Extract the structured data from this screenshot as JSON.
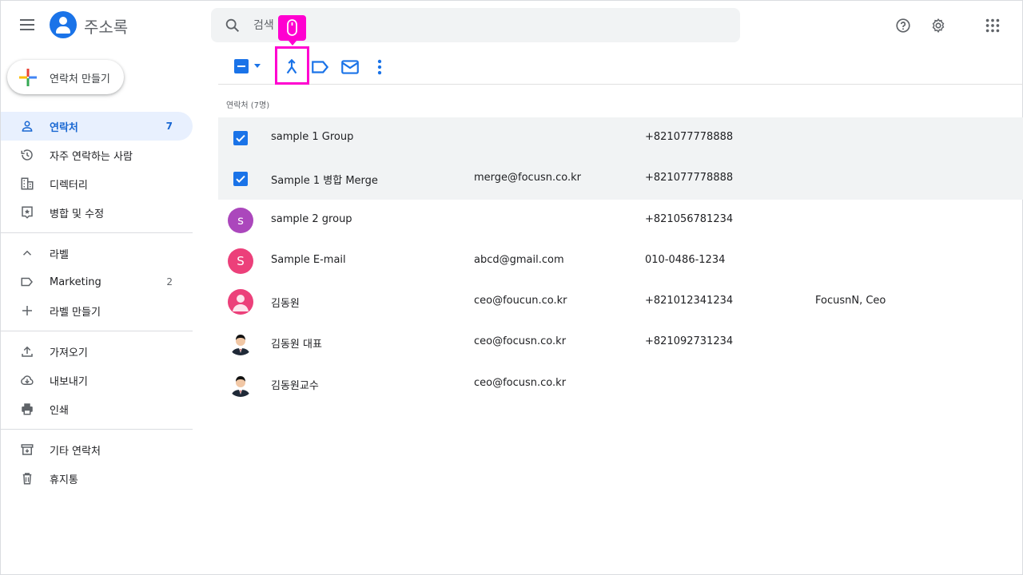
{
  "app": {
    "title": "주소록"
  },
  "search": {
    "placeholder": "검색"
  },
  "create_button": {
    "label": "연락처 만들기"
  },
  "sidebar": {
    "items": [
      {
        "label": "연락처",
        "count": "7",
        "active": true,
        "icon": "person-icon"
      },
      {
        "label": "자주 연락하는 사람",
        "count": "",
        "icon": "history-icon"
      },
      {
        "label": "디렉터리",
        "count": "",
        "icon": "building-icon"
      },
      {
        "label": "병합 및 수정",
        "count": "",
        "icon": "merge-fix-icon"
      }
    ],
    "labels_header": "라벨",
    "labels": [
      {
        "label": "Marketing",
        "count": "2",
        "icon": "label-icon"
      },
      {
        "label": "라벨 만들기",
        "count": "",
        "icon": "plus-icon"
      }
    ],
    "tools": [
      {
        "label": "가져오기",
        "icon": "upload-icon"
      },
      {
        "label": "내보내기",
        "icon": "cloud-download-icon"
      },
      {
        "label": "인쇄",
        "icon": "print-icon"
      }
    ],
    "other": [
      {
        "label": "기타 연락처",
        "icon": "archive-icon"
      },
      {
        "label": "휴지통",
        "icon": "trash-icon"
      }
    ]
  },
  "list": {
    "header": "연락처 (7명)",
    "rows": [
      {
        "name": "sample 1 Group",
        "email": "",
        "phone": "+821077778888",
        "org": "",
        "selected": true
      },
      {
        "name": "Sample 1 병합 Merge",
        "email": "merge@focusn.co.kr",
        "phone": "+821077778888",
        "org": "",
        "selected": true
      },
      {
        "name": "sample 2 group",
        "email": "",
        "phone": "+821056781234",
        "org": "",
        "avatar_letter": "s",
        "avatar_color": "#ab47bc"
      },
      {
        "name": "Sample E-mail",
        "email": "abcd@gmail.com",
        "phone": "010-0486-1234",
        "org": "",
        "avatar_letter": "S",
        "avatar_color": "#ec407a"
      },
      {
        "name": "김동원",
        "email": "ceo@foucun.co.kr",
        "phone": "+821012341234",
        "org": "FocusnN, Ceo",
        "avatar_color": "#ec407a"
      },
      {
        "name": "김동원 대표",
        "email": "ceo@focusn.co.kr",
        "phone": "+821092731234",
        "org": ""
      },
      {
        "name": "김동원교수",
        "email": "ceo@focusn.co.kr",
        "phone": "",
        "org": ""
      }
    ]
  },
  "colors": {
    "accent": "#1a73e8",
    "highlight": "#ff00d0",
    "selected_row": "#f1f3f4"
  }
}
